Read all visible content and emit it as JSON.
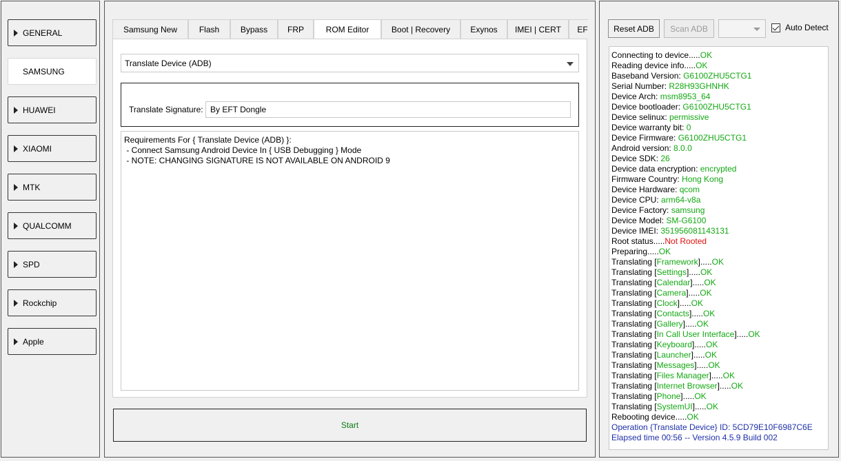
{
  "sidebar": {
    "items": [
      {
        "label": "GENERAL",
        "active": false
      },
      {
        "label": "SAMSUNG",
        "active": true
      },
      {
        "label": "HUAWEI",
        "active": false
      },
      {
        "label": "XIAOMI",
        "active": false
      },
      {
        "label": "MTK",
        "active": false
      },
      {
        "label": "QUALCOMM",
        "active": false
      },
      {
        "label": "SPD",
        "active": false
      },
      {
        "label": "Rockchip",
        "active": false
      },
      {
        "label": "Apple",
        "active": false
      }
    ]
  },
  "tabs": [
    {
      "label": "Samsung New",
      "active": false
    },
    {
      "label": "Flash",
      "active": false
    },
    {
      "label": "Bypass",
      "active": false
    },
    {
      "label": "FRP",
      "active": false
    },
    {
      "label": "ROM Editor",
      "active": true
    },
    {
      "label": "Boot | Recovery",
      "active": false
    },
    {
      "label": "Exynos",
      "active": false
    },
    {
      "label": "IMEI | CERT",
      "active": false
    },
    {
      "label": "EF",
      "active": false
    }
  ],
  "rom_editor": {
    "operation_selected": "Translate Device (ADB)",
    "signature_label": "Translate Signature:",
    "signature_value": "By EFT Dongle",
    "requirements": [
      "Requirements For { Translate Device (ADB) }:",
      " - Connect Samsung Android Device In { USB Debugging } Mode",
      " - NOTE: CHANGING SIGNATURE IS NOT AVAILABLE ON ANDROID 9"
    ]
  },
  "start_label": "Start",
  "toolbar": {
    "reset_adb_label": "Reset ADB",
    "scan_adb_label": "Scan ADB",
    "port_value": "",
    "auto_detect_label": "Auto Detect",
    "auto_detect_checked": true
  },
  "colors": {
    "ok_green": "#13a813",
    "error_red": "#e01010",
    "info_blue": "#1e2fa8",
    "start_green": "#0a7a12"
  },
  "log": [
    [
      {
        "t": "Connecting to device.....",
        "c": "black"
      },
      {
        "t": "OK",
        "c": "green"
      }
    ],
    [
      {
        "t": "Reading device info.....",
        "c": "black"
      },
      {
        "t": "OK",
        "c": "green"
      }
    ],
    [
      {
        "t": "Baseband Version: ",
        "c": "black"
      },
      {
        "t": "G6100ZHU5CTG1",
        "c": "green"
      }
    ],
    [
      {
        "t": "Serial Number: ",
        "c": "black"
      },
      {
        "t": "R28H93GHNHK",
        "c": "green"
      }
    ],
    [
      {
        "t": "Device Arch: ",
        "c": "black"
      },
      {
        "t": "msm8953_64",
        "c": "green"
      }
    ],
    [
      {
        "t": "Device bootloader: ",
        "c": "black"
      },
      {
        "t": "G6100ZHU5CTG1",
        "c": "green"
      }
    ],
    [
      {
        "t": "Device selinux: ",
        "c": "black"
      },
      {
        "t": "permissive",
        "c": "green"
      }
    ],
    [
      {
        "t": "Device warranty bit: ",
        "c": "black"
      },
      {
        "t": "0",
        "c": "green"
      }
    ],
    [
      {
        "t": "Device Firmware: ",
        "c": "black"
      },
      {
        "t": "G6100ZHU5CTG1",
        "c": "green"
      }
    ],
    [
      {
        "t": "Android version: ",
        "c": "black"
      },
      {
        "t": "8.0.0",
        "c": "green"
      }
    ],
    [
      {
        "t": "Device SDK: ",
        "c": "black"
      },
      {
        "t": "26",
        "c": "green"
      }
    ],
    [
      {
        "t": "Device data encryption: ",
        "c": "black"
      },
      {
        "t": "encrypted",
        "c": "green"
      }
    ],
    [
      {
        "t": "Firmware Country: ",
        "c": "black"
      },
      {
        "t": "Hong Kong",
        "c": "green"
      }
    ],
    [
      {
        "t": "Device Hardware: ",
        "c": "black"
      },
      {
        "t": "qcom",
        "c": "green"
      }
    ],
    [
      {
        "t": "Device CPU: ",
        "c": "black"
      },
      {
        "t": "arm64-v8a",
        "c": "green"
      }
    ],
    [
      {
        "t": "Device Factory: ",
        "c": "black"
      },
      {
        "t": "samsung",
        "c": "green"
      }
    ],
    [
      {
        "t": "Device Model: ",
        "c": "black"
      },
      {
        "t": "SM-G6100",
        "c": "green"
      }
    ],
    [
      {
        "t": "Device IMEI: ",
        "c": "black"
      },
      {
        "t": "351956081143131",
        "c": "green"
      }
    ],
    [
      {
        "t": "Root status.....",
        "c": "black"
      },
      {
        "t": "Not Rooted",
        "c": "red"
      }
    ],
    [
      {
        "t": "Preparing.....",
        "c": "black"
      },
      {
        "t": "OK",
        "c": "green"
      }
    ],
    [
      {
        "t": "Translating [",
        "c": "black"
      },
      {
        "t": "Framework",
        "c": "green"
      },
      {
        "t": "].....",
        "c": "black"
      },
      {
        "t": "OK",
        "c": "green"
      }
    ],
    [
      {
        "t": "Translating [",
        "c": "black"
      },
      {
        "t": "Settings",
        "c": "green"
      },
      {
        "t": "].....",
        "c": "black"
      },
      {
        "t": "OK",
        "c": "green"
      }
    ],
    [
      {
        "t": "Translating [",
        "c": "black"
      },
      {
        "t": "Calendar",
        "c": "green"
      },
      {
        "t": "].....",
        "c": "black"
      },
      {
        "t": "OK",
        "c": "green"
      }
    ],
    [
      {
        "t": "Translating [",
        "c": "black"
      },
      {
        "t": "Camera",
        "c": "green"
      },
      {
        "t": "].....",
        "c": "black"
      },
      {
        "t": "OK",
        "c": "green"
      }
    ],
    [
      {
        "t": "Translating [",
        "c": "black"
      },
      {
        "t": "Clock",
        "c": "green"
      },
      {
        "t": "].....",
        "c": "black"
      },
      {
        "t": "OK",
        "c": "green"
      }
    ],
    [
      {
        "t": "Translating [",
        "c": "black"
      },
      {
        "t": "Contacts",
        "c": "green"
      },
      {
        "t": "].....",
        "c": "black"
      },
      {
        "t": "OK",
        "c": "green"
      }
    ],
    [
      {
        "t": "Translating [",
        "c": "black"
      },
      {
        "t": "Gallery",
        "c": "green"
      },
      {
        "t": "].....",
        "c": "black"
      },
      {
        "t": "OK",
        "c": "green"
      }
    ],
    [
      {
        "t": "Translating [",
        "c": "black"
      },
      {
        "t": "In Call User Interface",
        "c": "green"
      },
      {
        "t": "].....",
        "c": "black"
      },
      {
        "t": "OK",
        "c": "green"
      }
    ],
    [
      {
        "t": "Translating [",
        "c": "black"
      },
      {
        "t": "Keyboard",
        "c": "green"
      },
      {
        "t": "].....",
        "c": "black"
      },
      {
        "t": "OK",
        "c": "green"
      }
    ],
    [
      {
        "t": "Translating [",
        "c": "black"
      },
      {
        "t": "Launcher",
        "c": "green"
      },
      {
        "t": "].....",
        "c": "black"
      },
      {
        "t": "OK",
        "c": "green"
      }
    ],
    [
      {
        "t": "Translating [",
        "c": "black"
      },
      {
        "t": "Messages",
        "c": "green"
      },
      {
        "t": "].....",
        "c": "black"
      },
      {
        "t": "OK",
        "c": "green"
      }
    ],
    [
      {
        "t": "Translating [",
        "c": "black"
      },
      {
        "t": "Files Manager",
        "c": "green"
      },
      {
        "t": "].....",
        "c": "black"
      },
      {
        "t": "OK",
        "c": "green"
      }
    ],
    [
      {
        "t": "Translating [",
        "c": "black"
      },
      {
        "t": "Internet Browser",
        "c": "green"
      },
      {
        "t": "].....",
        "c": "black"
      },
      {
        "t": "OK",
        "c": "green"
      }
    ],
    [
      {
        "t": "Translating [",
        "c": "black"
      },
      {
        "t": "Phone",
        "c": "green"
      },
      {
        "t": "].....",
        "c": "black"
      },
      {
        "t": "OK",
        "c": "green"
      }
    ],
    [
      {
        "t": "Translating [",
        "c": "black"
      },
      {
        "t": "SystemUI",
        "c": "green"
      },
      {
        "t": "].....",
        "c": "black"
      },
      {
        "t": "OK",
        "c": "green"
      }
    ],
    [
      {
        "t": "Rebooting device.....",
        "c": "black"
      },
      {
        "t": "OK",
        "c": "green"
      }
    ],
    [
      {
        "t": "Operation {Translate Device} ID: 5CD79E10F6987C6E",
        "c": "blue"
      }
    ],
    [
      {
        "t": "Elapsed time 00:56 -- Version 4.5.9 Build 002",
        "c": "blue"
      }
    ]
  ]
}
